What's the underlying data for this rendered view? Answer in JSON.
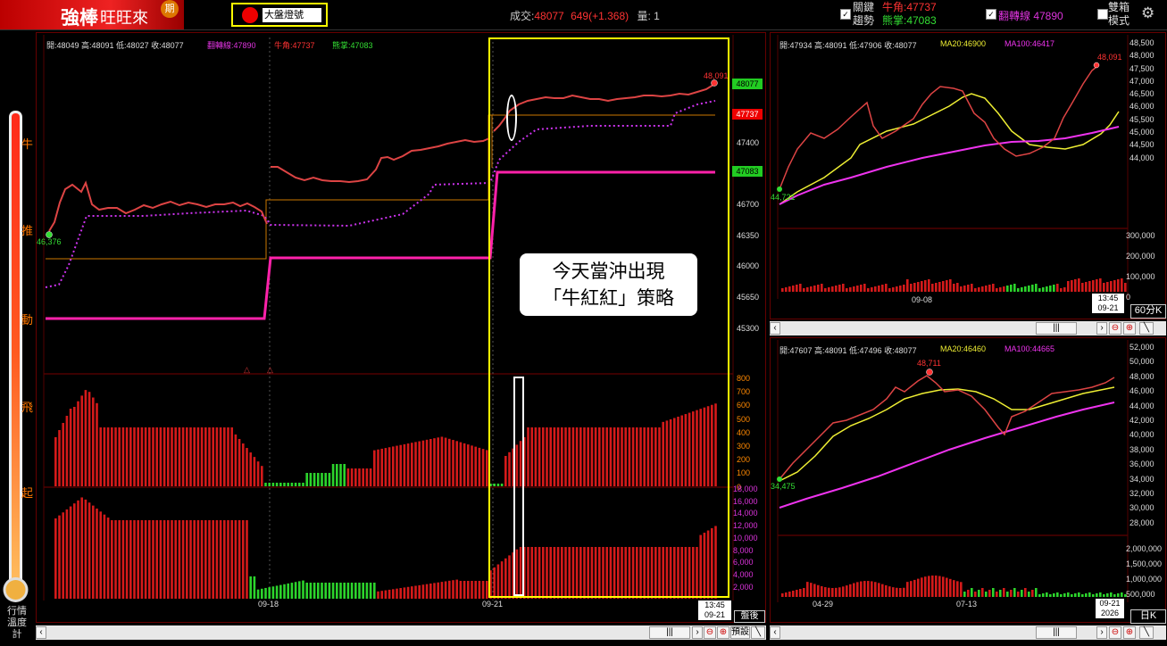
{
  "header": {
    "logo_main": "強棒",
    "logo_sub": "旺旺來",
    "logo_badge": "期",
    "light_label": "大盤燈號",
    "trade_label": "成交:",
    "trade_value": "48077",
    "trade_change": "649(+1.368)",
    "volume_label": "量:",
    "volume_value": "1",
    "key_trend_1": "關鍵",
    "key_trend_2": "趨勢",
    "bull_horn": "牛角:47737",
    "bear_palm": "熊掌:47083",
    "reversal_line": "翻轉線 47890",
    "dual_1": "雙箱",
    "dual_2": "模式"
  },
  "thermometer": {
    "levels": [
      "牛",
      "推",
      "動",
      "飛",
      "起"
    ],
    "caption_1": "行情",
    "caption_2": "溫度計"
  },
  "main_chart": {
    "info_ohlc": "開:48049 高:48091 低:48027 收:48077",
    "info_reversal": "翻轉線:47890",
    "info_bull": "牛角:47737",
    "info_bear": "熊掌:47083",
    "price_ticks": [
      "47400",
      "46700",
      "46350",
      "46000",
      "45650",
      "45300"
    ],
    "tag_close": "48077",
    "tag_bull": "47737",
    "tag_bear": "47083",
    "high_label": "48,091",
    "low_label": "46,376",
    "ind1_ticks": [
      "800",
      "700",
      "600",
      "500",
      "400",
      "300",
      "200",
      "100",
      "0"
    ],
    "ind2_ticks": [
      "18,000",
      "16,000",
      "14,000",
      "12,000",
      "10,000",
      "8,000",
      "6,000",
      "4,000",
      "2,000"
    ],
    "dates": [
      "09-18",
      "09-21"
    ],
    "time_stamp_1": "13:45",
    "time_stamp_2": "09-21",
    "session": "盤後",
    "callout_1": "今天當沖出現",
    "callout_2": "「牛紅紅」策略"
  },
  "right_top": {
    "info_ohlc": "開:47934 高:48091 低:47906 收:48077",
    "info_ma20": "MA20:46900",
    "info_ma100": "MA100:46417",
    "price_ticks": [
      "48,500",
      "48,000",
      "47,500",
      "47,000",
      "46,500",
      "46,000",
      "45,500",
      "45,000",
      "44,500",
      "44,000"
    ],
    "vol_ticks": [
      "300,000",
      "200,000",
      "100,000",
      "0"
    ],
    "high_label": "48,091",
    "low_label": "44,721",
    "date": "09-08",
    "time_1": "13:45",
    "time_2": "09-21",
    "period": "60分K"
  },
  "right_bottom": {
    "info_ohlc": "開:47607 高:48091 低:47496 收:48077",
    "info_ma20": "MA20:46460",
    "info_ma100": "MA100:44665",
    "price_ticks": [
      "52,000",
      "50,000",
      "48,000",
      "46,000",
      "44,000",
      "42,000",
      "40,000",
      "38,000",
      "36,000",
      "34,000",
      "32,000",
      "30,000",
      "28,000"
    ],
    "vol_ticks": [
      "2,000,000",
      "1,500,000",
      "1,000,000",
      "500,000"
    ],
    "high_label": "48,711",
    "low_label": "34,475",
    "dates": [
      "04-29",
      "07-13"
    ],
    "time_1": "09-21",
    "time_2": "2026",
    "period": "日K"
  },
  "scrollbar": {
    "preset": "預設"
  }
}
